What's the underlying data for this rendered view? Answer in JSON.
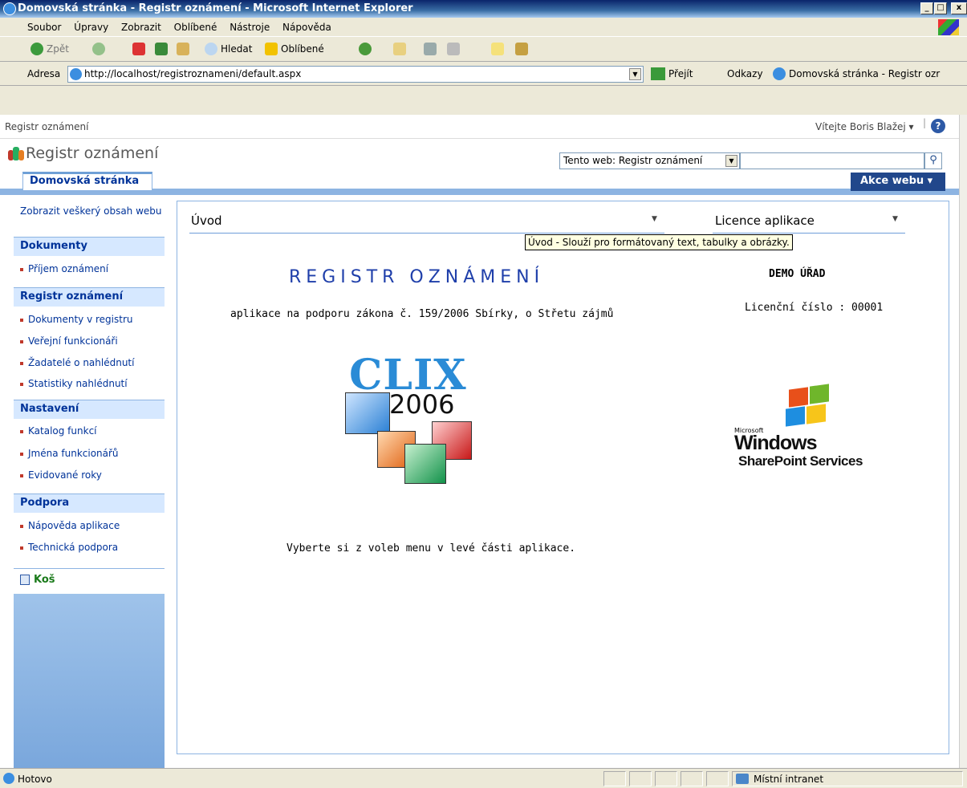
{
  "window": {
    "title": "Domovská stránka - Registr oznámení - Microsoft Internet Explorer",
    "min_symbol": "_",
    "max_symbol": "□",
    "close_symbol": "x"
  },
  "menu": [
    "Soubor",
    "Úpravy",
    "Zobrazit",
    "Oblíbené",
    "Nástroje",
    "Nápověda"
  ],
  "toolbar": {
    "back": "Zpět",
    "search": "Hledat",
    "favorites": "Oblíbené"
  },
  "address": {
    "label": "Adresa",
    "url": "http://localhost/registroznameni/default.aspx",
    "go": "Přejít",
    "links": "Odkazy",
    "link1": "Domovská stránka - Registr ozr"
  },
  "sharepoint": {
    "breadcrumb": "Registr oznámení",
    "welcome": "Vítejte Boris Blažej ▾",
    "help_symbol": "?",
    "site_title": "Registr oznámení",
    "search_scope": "Tento web: Registr oznámení",
    "search_placeholder": "",
    "home_tab": "Domovská stránka",
    "site_actions": "Akce webu ▾"
  },
  "quicklaunch": {
    "view_all": "Zobrazit veškerý obsah webu",
    "sections": [
      {
        "title": "Dokumenty",
        "items": [
          "Příjem oznámení"
        ]
      },
      {
        "title": "Registr oznámení",
        "items": [
          "Dokumenty v registru",
          "Veřejní funkcionáři",
          "Žadatelé o nahlédnutí",
          "Statistiky nahlédnutí"
        ]
      },
      {
        "title": "Nastavení",
        "items": [
          "Katalog funkcí",
          "Jména funkcionářů",
          "Evidované roky"
        ]
      },
      {
        "title": "Podpora",
        "items": [
          "Nápověda aplikace",
          "Technická podpora"
        ]
      }
    ],
    "recycle": "Koš"
  },
  "main": {
    "wp1_title": "Úvod",
    "wp2_title": "Licence aplikace",
    "tooltip": "Úvod - Slouží pro formátovaný text, tabulky a obrázky.",
    "app_title": "REGISTR OZNÁMENÍ",
    "subtitle": "aplikace na podporu zákona č. 159/2006 Sbírky,  o Střetu zájmů",
    "org": "DEMO ÚŘAD",
    "licence": "Licenční číslo : 00001",
    "choose": "Vyberte si z voleb menu v levé části aplikace.",
    "clix_word": "CLIX",
    "clix_year": "2006",
    "ms_small": "Microsoft",
    "windows": "Windows",
    "sps": "SharePoint Services"
  },
  "status": {
    "left": "Hotovo",
    "zone": "Místní intranet"
  },
  "colors": {
    "accent": "#21478B",
    "nav_light": "#D6E8FF",
    "frame": "#8DB4E2",
    "title_blue": "#1F3FAA"
  }
}
